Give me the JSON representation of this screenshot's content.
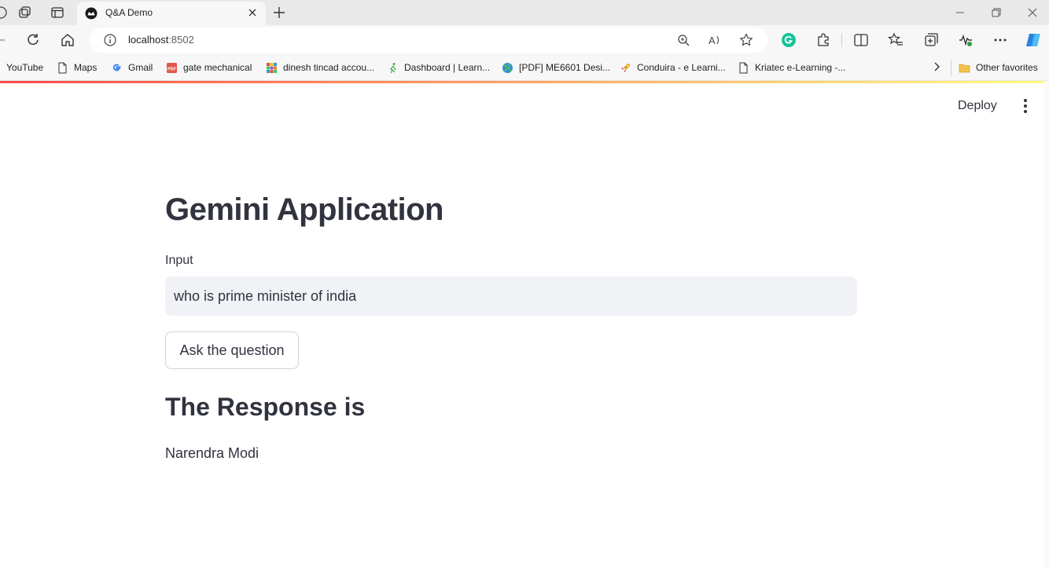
{
  "browser": {
    "tab": {
      "title": "Q&A Demo"
    },
    "address": {
      "host": "localhost",
      "port": ":8502"
    },
    "favorites": [
      {
        "label": "YouTube",
        "icon": "youtube-icon"
      },
      {
        "label": "Maps",
        "icon": "page-icon"
      },
      {
        "label": "Gmail",
        "icon": "google-icon"
      },
      {
        "label": "gate mechanical",
        "icon": "pdf-icon"
      },
      {
        "label": "dinesh tincad accou...",
        "icon": "grid-icon"
      },
      {
        "label": "Dashboard | Learn...",
        "icon": "runner-icon"
      },
      {
        "label": "[PDF] ME6601 Desi...",
        "icon": "globe-icon"
      },
      {
        "label": "Conduira - e Learni...",
        "icon": "rocket-icon"
      },
      {
        "label": "Kriatec e-Learning -...",
        "icon": "page-icon"
      }
    ],
    "other_favorites": "Other favorites"
  },
  "app": {
    "deploy_label": "Deploy",
    "title": "Gemini Application",
    "input_label": "Input",
    "input_value": "who is prime minister of india",
    "button_label": "Ask the question",
    "response_header": "The Response is",
    "response_text": "Narendra Modi",
    "accent_gradient": [
      "#ff4b4b",
      "#fffd80"
    ]
  }
}
